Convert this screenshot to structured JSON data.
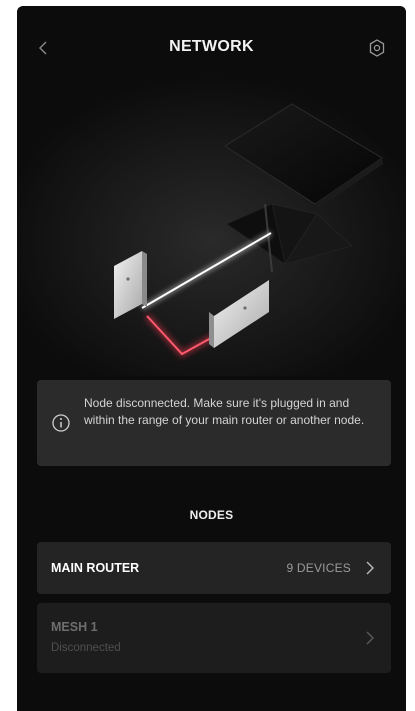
{
  "header": {
    "title": "NETWORK",
    "back_icon": "chevron-left-icon",
    "settings_icon": "gear-icon"
  },
  "alert": {
    "icon": "info-icon",
    "message": "Node disconnected. Make sure it's plugged in and within the range of your main router or another node."
  },
  "nodes_section": {
    "label": "NODES",
    "items": [
      {
        "name": "MAIN ROUTER",
        "detail": "9 DEVICES",
        "status": ""
      },
      {
        "name": "MESH 1",
        "detail": "",
        "status": "Disconnected"
      }
    ]
  },
  "colors": {
    "background": "#0c0c0c",
    "card": "#242424",
    "alert_bg": "#2b2b2b",
    "link_connected": "#ffffff",
    "link_disconnected": "#e0344a"
  }
}
